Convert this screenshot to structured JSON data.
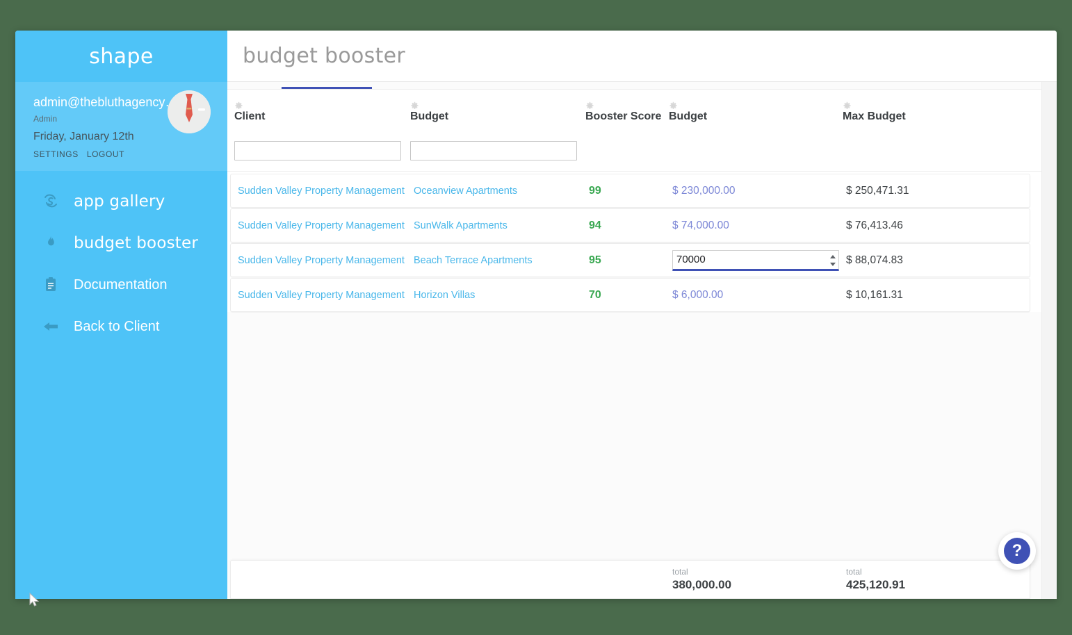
{
  "window": {
    "background_color": "#4a6b4c",
    "accent_blue": "#4ec3f7",
    "indicator_color": "#3f51b5"
  },
  "sidebar": {
    "logo": "shape",
    "logo_icon": "shape-wordmark",
    "user": {
      "email": "admin@thebluthagency…",
      "role": "Admin",
      "date": "Friday, January 12th",
      "settings_label": "SETTINGS",
      "logout_label": "LOGOUT",
      "avatar_icon": "necktie-avatar"
    },
    "items": [
      {
        "label": "app gallery",
        "icon": "shape-s-icon",
        "style": "script"
      },
      {
        "label": "budget booster",
        "icon": "flame-icon",
        "style": "script"
      },
      {
        "label": "Documentation",
        "icon": "clipboard-icon",
        "style": "plain"
      },
      {
        "label": "Back to Client",
        "icon": "arrow-left-icon",
        "style": "plain"
      }
    ]
  },
  "header": {
    "title": "budget booster"
  },
  "table": {
    "columns": [
      {
        "key": "client",
        "title": "Client",
        "gear_icon": "gear-icon",
        "filter_value": "",
        "filter_placeholder": "",
        "has_filter": true
      },
      {
        "key": "budget",
        "title": "Budget",
        "gear_icon": "gear-icon",
        "filter_value": "",
        "filter_placeholder": "",
        "has_filter": true
      },
      {
        "key": "score",
        "title": "Booster Score",
        "gear_icon": "gear-icon",
        "has_filter": false
      },
      {
        "key": "amount",
        "title": "Budget",
        "gear_icon": "gear-icon",
        "has_filter": false
      },
      {
        "key": "max",
        "title": "Max Budget",
        "gear_icon": "gear-icon",
        "has_filter": false
      }
    ],
    "rows": [
      {
        "client": "Sudden Valley Property Management",
        "budget": "Oceanview Apartments",
        "score": "99",
        "amount": "$ 230,000.00",
        "max": "$ 250,471.31",
        "editing": false
      },
      {
        "client": "Sudden Valley Property Management",
        "budget": "SunWalk Apartments",
        "score": "94",
        "amount": "$ 74,000.00",
        "max": "$ 76,413.46",
        "editing": false
      },
      {
        "client": "Sudden Valley Property Management",
        "budget": "Beach Terrace Apartments",
        "score": "95",
        "amount": "70000",
        "max": "$ 88,074.83",
        "editing": true
      },
      {
        "client": "Sudden Valley Property Management",
        "budget": "Horizon Villas",
        "score": "70",
        "amount": "$ 6,000.00",
        "max": "$ 10,161.31",
        "editing": false
      }
    ],
    "totals": {
      "amount_label": "total",
      "amount_value": "380,000.00",
      "max_label": "total",
      "max_value": "425,120.91"
    }
  },
  "help": {
    "label": "?"
  }
}
